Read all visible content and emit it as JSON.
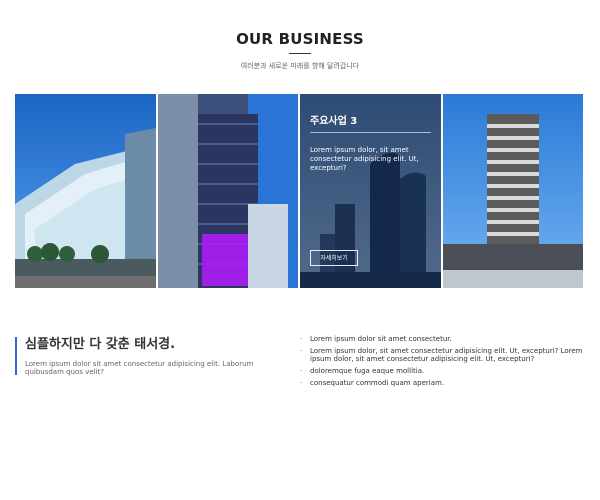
{
  "header": {
    "title": "OUR BUSINESS",
    "subtitle": "여러분과 새로운 미래를 향해 달려갑니다"
  },
  "tiles": [
    {
      "image": "convention-center-photo"
    },
    {
      "image": "glass-tower-photo"
    },
    {
      "image": "city-skyline-photo",
      "heading": "주요사업 3",
      "desc": "Lorem ipsum dolor, sit amet consectetur adipisicing elit. Ut, excepturi?",
      "button": "자세히보기"
    },
    {
      "image": "striped-tower-photo"
    }
  ],
  "about": {
    "heading": "심플하지만 다 갖춘 태서경.",
    "text": "Lorem ipsum dolor sit amet consectetur adipisicing elit. Laborum quibusdam quos velit?"
  },
  "list_items": [
    "Lorem ipsum dolor sit amet consectetur.",
    "Lorem ipsum dolor, sit amet consectetur adipisicing elit. Ut, excepturi? Lorem ipsum dolor, sit amet consectetur adipisicing elit. Ut, excepturi?",
    "doloremque fuga eaque mollitia.",
    "consequatur commodi quam aperiam."
  ],
  "colors": {
    "accent": "#2c6bd6",
    "overlay": "#06214e"
  }
}
